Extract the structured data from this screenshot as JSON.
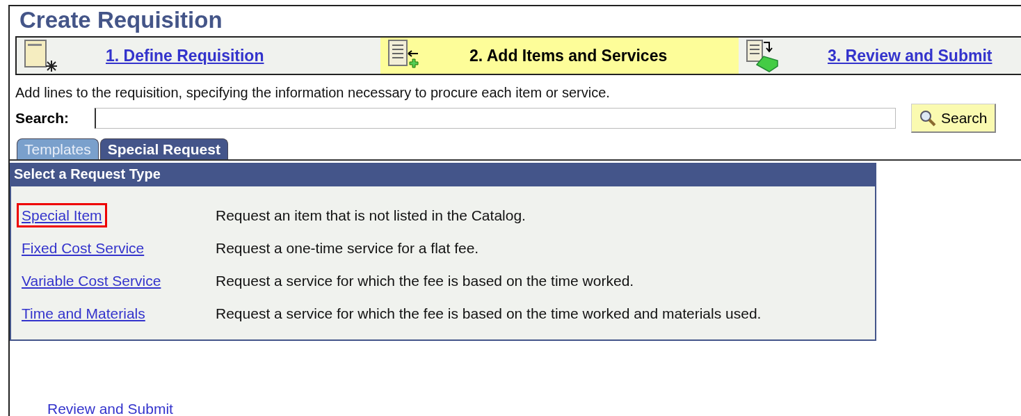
{
  "title": "Create Requisition",
  "steps": [
    {
      "label": "1. Define Requisition",
      "selected": false,
      "kind": "define"
    },
    {
      "label": "2. Add Items and Services",
      "selected": true,
      "kind": "add"
    },
    {
      "label": "3. Review and Submit",
      "selected": false,
      "kind": "review"
    }
  ],
  "instructions": "Add lines to the requisition, specifying the information necessary to procure each item or service.",
  "search": {
    "label": "Search:",
    "button": "Search"
  },
  "tabs": [
    {
      "label": "Templates",
      "selected": false
    },
    {
      "label": "Special Request",
      "selected": true
    }
  ],
  "panel": {
    "title": "Select a Request Type",
    "rows": [
      {
        "link": "Special Item",
        "description": "Request an item that is not listed in the Catalog.",
        "highlighted": true
      },
      {
        "link": "Fixed Cost Service",
        "description": "Request a one-time service for a flat fee.",
        "highlighted": false
      },
      {
        "link": "Variable Cost Service",
        "description": "Request a service for which the fee is based on the time worked.",
        "highlighted": false
      },
      {
        "link": "Time and Materials",
        "description": "Request a service for which the fee is based on the time worked and materials used.",
        "highlighted": false
      }
    ]
  },
  "footer_link": "Review and Submit"
}
